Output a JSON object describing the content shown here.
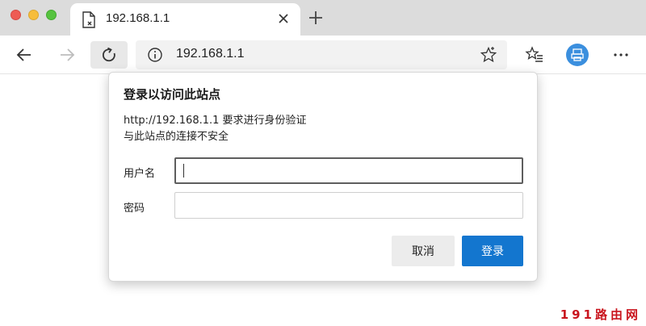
{
  "tab": {
    "title": "192.168.1.1"
  },
  "address_bar": {
    "url": "192.168.1.1"
  },
  "dialog": {
    "title": "登录以访问此站点",
    "message_line1": "http://192.168.1.1 要求进行身份验证",
    "message_line2": "与此站点的连接不安全",
    "username_label": "用户名",
    "password_label": "密码",
    "username_value": "",
    "password_value": "",
    "cancel_label": "取消",
    "login_label": "登录"
  },
  "watermark": "191路由网",
  "colors": {
    "accent": "#1376cf",
    "profile": "#3b8fde",
    "watermark": "#c9151e",
    "close_red": "#ee5c54",
    "minimize_yellow": "#f6bd3b",
    "zoom_green": "#56c33f"
  },
  "icons": {
    "back": "back-arrow-icon",
    "forward": "forward-arrow-icon",
    "refresh": "refresh-icon",
    "info": "info-icon",
    "favorite": "star-icon",
    "favorites_list": "favorites-list-icon",
    "profile": "profile-icon",
    "more": "more-icon"
  }
}
